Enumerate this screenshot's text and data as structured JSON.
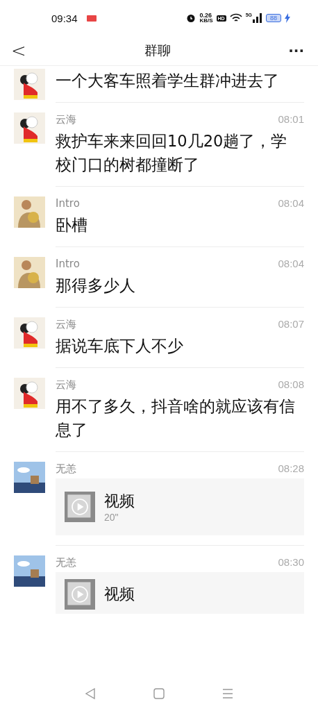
{
  "status_bar": {
    "time": "09:34",
    "speed_value": "0.26",
    "speed_unit": "KB/S",
    "hd": "HD",
    "network": "5G",
    "battery": "88"
  },
  "header": {
    "title": "群聊",
    "back": "<",
    "more": "···"
  },
  "messages": [
    {
      "kind": "text",
      "avatar": {
        "kind": "cartoon"
      },
      "text": "一个大客车照着学生群冲进去了"
    },
    {
      "kind": "text",
      "avatar": {
        "kind": "cartoon"
      },
      "sender": "云海",
      "time": "08:01",
      "text": "救护车来来回回10几20趟了，学校门口的树都撞断了"
    },
    {
      "kind": "text",
      "avatar": {
        "kind": "bouquet"
      },
      "sender": "Intro",
      "time": "08:04",
      "text": "卧槽"
    },
    {
      "kind": "text",
      "avatar": {
        "kind": "bouquet"
      },
      "sender": "Intro",
      "time": "08:04",
      "text": "那得多少人"
    },
    {
      "kind": "text",
      "avatar": {
        "kind": "cartoon"
      },
      "sender": "云海",
      "time": "08:07",
      "text": "据说车底下人不少"
    },
    {
      "kind": "text",
      "avatar": {
        "kind": "cartoon"
      },
      "sender": "云海",
      "time": "08:08",
      "text": "用不了多久，抖音啥的就应该有信息了"
    },
    {
      "kind": "video",
      "avatar": {
        "kind": "sky"
      },
      "sender": "无恙",
      "time": "08:28",
      "text": "视频",
      "duration": "20\""
    },
    {
      "kind": "video",
      "avatar": {
        "kind": "sky"
      },
      "sender": "无恙",
      "time": "08:30",
      "text": "视频"
    }
  ]
}
